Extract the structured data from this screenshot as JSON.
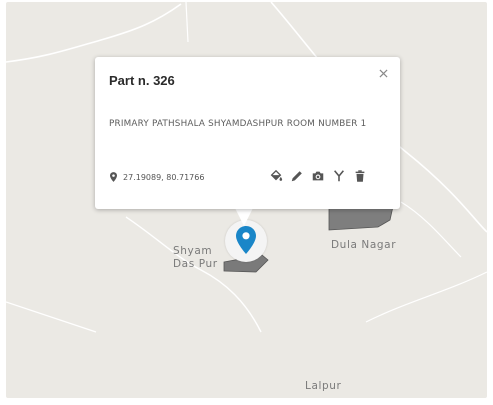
{
  "map": {
    "labels": {
      "shyam_line1": "Shyam",
      "shyam_line2": "Das Pur",
      "dula_nagar": "Dula Nagar",
      "lalpur": "Lalpur"
    },
    "colors": {
      "land": "#ebe9e4",
      "road": "#ffffff",
      "parcel": "#7a7a7a",
      "marker": "#1a86c8"
    }
  },
  "popup": {
    "title": "Part n. 326",
    "description": "PRIMARY PATHSHALA SHYAMDASHPUR ROOM NUMBER 1",
    "coordinates": "27.19089, 80.71766",
    "close_icon": "close-icon",
    "actions": [
      {
        "icon": "paint-bucket-icon"
      },
      {
        "icon": "pencil-icon"
      },
      {
        "icon": "camera-icon"
      },
      {
        "icon": "fork-icon"
      },
      {
        "icon": "trash-icon"
      }
    ]
  }
}
